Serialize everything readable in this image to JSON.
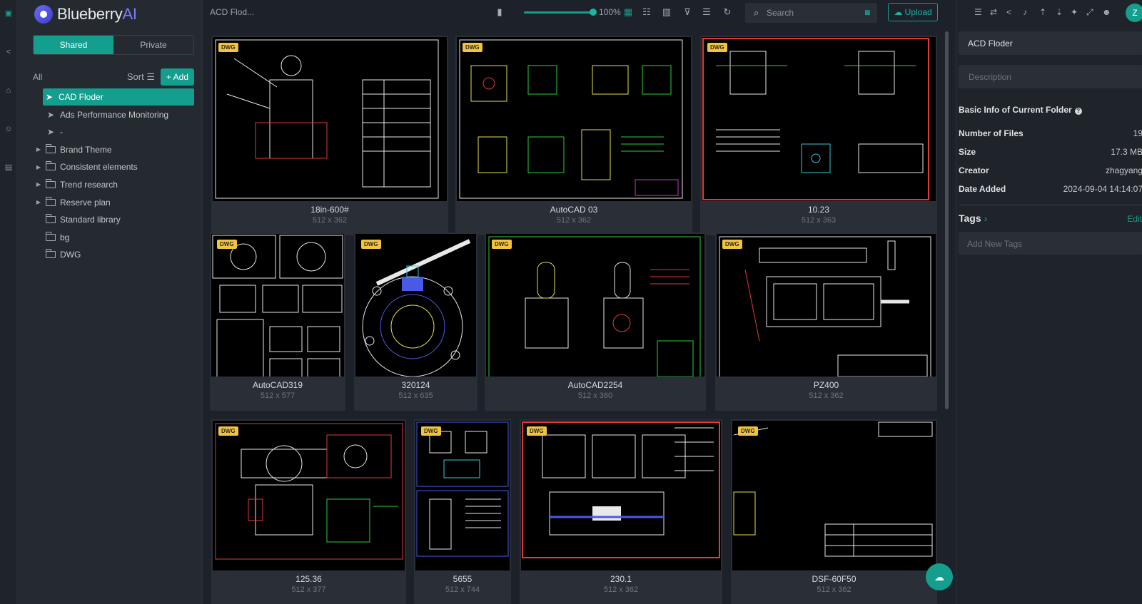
{
  "app": {
    "name_part1": "Blueberry",
    "name_part2": "AI"
  },
  "sidebar": {
    "tabs": [
      "Shared",
      "Private"
    ],
    "all_label": "All",
    "sort_label": "Sort",
    "add_label": "+ Add",
    "items": [
      {
        "label": "CAD Floder",
        "type": "shared",
        "selected": true
      },
      {
        "label": "Ads Performance Monitoring",
        "type": "shared"
      },
      {
        "label": "-",
        "type": "shared"
      },
      {
        "label": "Brand Theme",
        "type": "folder",
        "expandable": true
      },
      {
        "label": "Consistent elements",
        "type": "folder",
        "expandable": true
      },
      {
        "label": "Trend research",
        "type": "folder",
        "expandable": true
      },
      {
        "label": "Reserve plan",
        "type": "folder",
        "expandable": true
      },
      {
        "label": "Standard library",
        "type": "folder"
      },
      {
        "label": "bg",
        "type": "folder"
      },
      {
        "label": "DWG",
        "type": "folder"
      }
    ]
  },
  "topbar": {
    "breadcrumb": "ACD Flod...",
    "zoom": "100%",
    "search_placeholder": "Search",
    "upload_label": "Upload"
  },
  "files": [
    {
      "name": "18in-600#",
      "dims": "512 x 362",
      "badge": "DWG"
    },
    {
      "name": "AutoCAD 03",
      "dims": "512 x 362",
      "badge": "DWG"
    },
    {
      "name": "10.23",
      "dims": "512 x 363",
      "badge": "DWG"
    },
    {
      "name": "AutoCAD319",
      "dims": "512 x 577",
      "badge": "DWG"
    },
    {
      "name": "320124",
      "dims": "512 x 635",
      "badge": "DWG"
    },
    {
      "name": "AutoCAD2254",
      "dims": "512 x 360",
      "badge": "DWG"
    },
    {
      "name": "PZ400",
      "dims": "512 x 362",
      "badge": "DWG"
    },
    {
      "name": "125.36",
      "dims": "512 x 377",
      "badge": "DWG"
    },
    {
      "name": "5655",
      "dims": "512 x 744",
      "badge": "DWG"
    },
    {
      "name": "230.1",
      "dims": "512 x 362",
      "badge": "DWG"
    },
    {
      "name": "DSF-60F50",
      "dims": "512 x 362",
      "badge": "DWG"
    }
  ],
  "details": {
    "folder_name": "ACD Floder",
    "description_placeholder": "Description",
    "section_title": "Basic Info of Current Folder",
    "rows": [
      {
        "key": "Number of Files",
        "value": "19"
      },
      {
        "key": "Size",
        "value": "17.3 MB"
      },
      {
        "key": "Creator",
        "value": "zhagyang"
      },
      {
        "key": "Date Added",
        "value": "2024-09-04 14:14:07"
      }
    ],
    "tags_title": "Tags",
    "tags_edit": "Edit",
    "tags_placeholder": "Add New Tags",
    "avatar_letter": "Z"
  },
  "colors": {
    "accent": "#149e8e",
    "badge": "#f2c43c",
    "bg": "#1d2129"
  }
}
